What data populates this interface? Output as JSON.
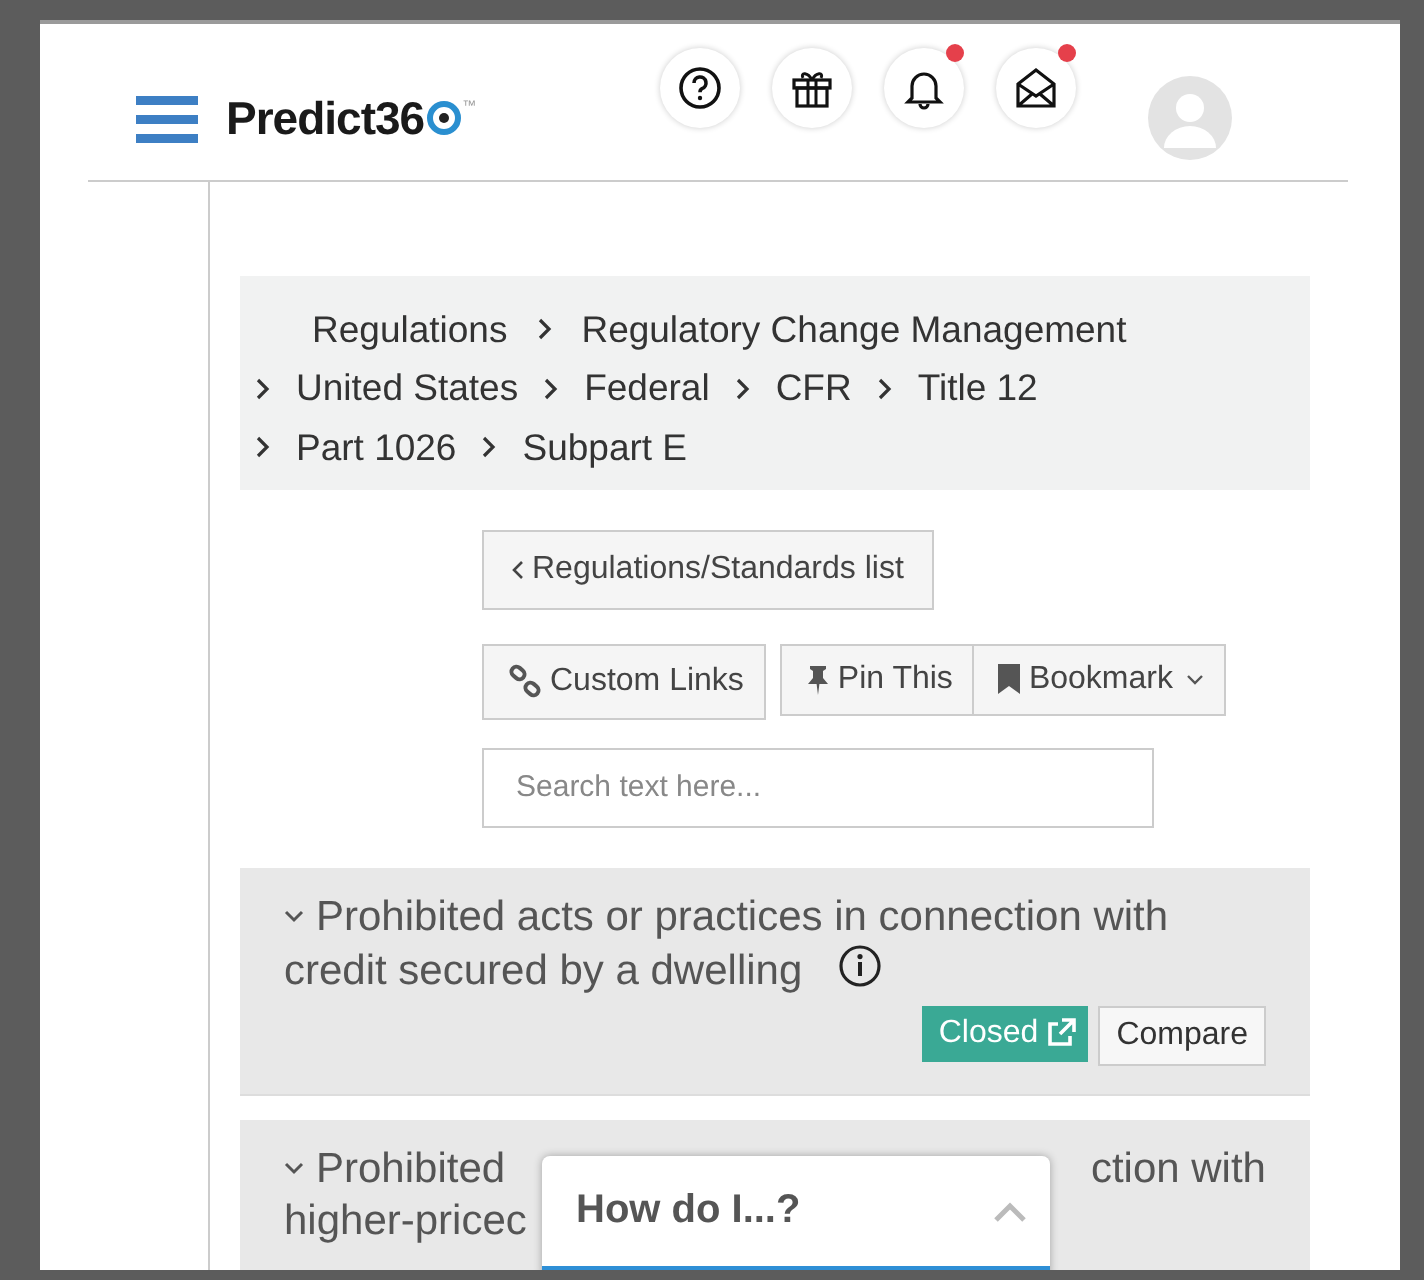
{
  "header": {
    "logo": "Predict36",
    "trademark": "™",
    "icons": [
      {
        "kind": "help",
        "badge": false
      },
      {
        "kind": "gift",
        "badge": false
      },
      {
        "kind": "bell",
        "badge": true
      },
      {
        "kind": "mail",
        "badge": true
      }
    ]
  },
  "breadcrumbs": [
    [
      "Regulations",
      "Regulatory Change Management"
    ],
    [
      "United States",
      "Federal",
      "CFR",
      "Title 12"
    ],
    [
      "Part 1026",
      "Subpart E"
    ]
  ],
  "back_button": {
    "label": "Regulations/Standards list"
  },
  "actions": {
    "custom_links": "Custom Links",
    "pin": "Pin This",
    "bookmark": "Bookmark"
  },
  "search": {
    "placeholder": "Search text here..."
  },
  "items": [
    {
      "title": "Prohibited acts or practices in connection with credit secured by a dwelling",
      "info": true,
      "status": "Closed",
      "compare": "Compare"
    }
  ],
  "partial_item": {
    "line1_start": "Prohibited",
    "line1_end": "ction with",
    "line2": "higher-pricec"
  },
  "help_panel": {
    "title": "How do I...?",
    "expanded": true
  }
}
